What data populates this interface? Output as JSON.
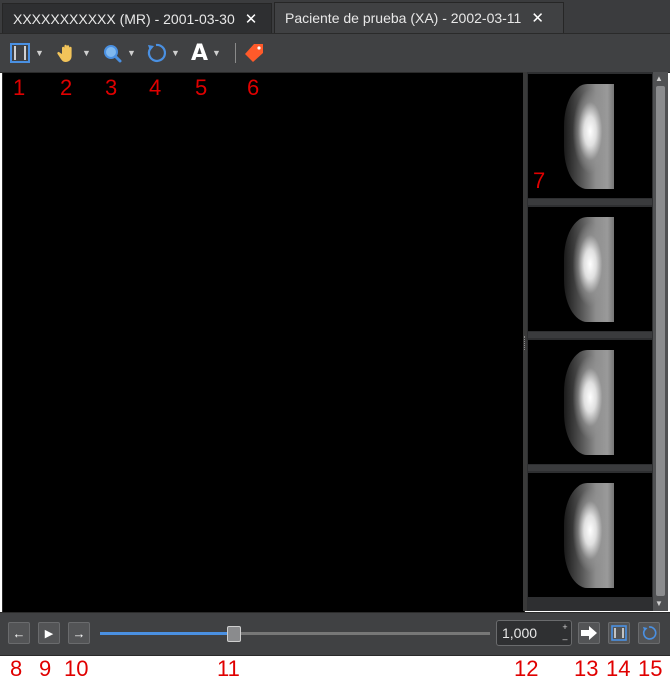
{
  "tabs": [
    {
      "label": "XXXXXXXXXXX (MR) - 2001-03-30",
      "close": "✕"
    },
    {
      "label": "Paciente de prueba (XA) - 2002-03-11",
      "close": "✕"
    }
  ],
  "toolbar": {
    "tools": [
      {
        "icon": "layout-icon"
      },
      {
        "icon": "pan-hand-icon"
      },
      {
        "icon": "zoom-icon"
      },
      {
        "icon": "rotate-icon"
      },
      {
        "icon": "text-annotation-icon",
        "glyph": "A"
      },
      {
        "icon": "tag-icon"
      }
    ],
    "caret": "▼"
  },
  "thumbnails": {
    "count": 4
  },
  "player": {
    "prev_glyph": "←",
    "play_glyph": "▶",
    "next_glyph": "→",
    "progress": 0.34,
    "speed_value": "1,000",
    "spin_up": "+",
    "spin_down": "–"
  },
  "callouts": [
    "1",
    "2",
    "3",
    "4",
    "5",
    "6",
    "7",
    "8",
    "9",
    "10",
    "11",
    "12",
    "13",
    "14",
    "15"
  ],
  "colors": {
    "accent": "#4a90e2",
    "callout": "#e00000",
    "tag": "#ff5a2a",
    "hand": "#f2c45a"
  }
}
